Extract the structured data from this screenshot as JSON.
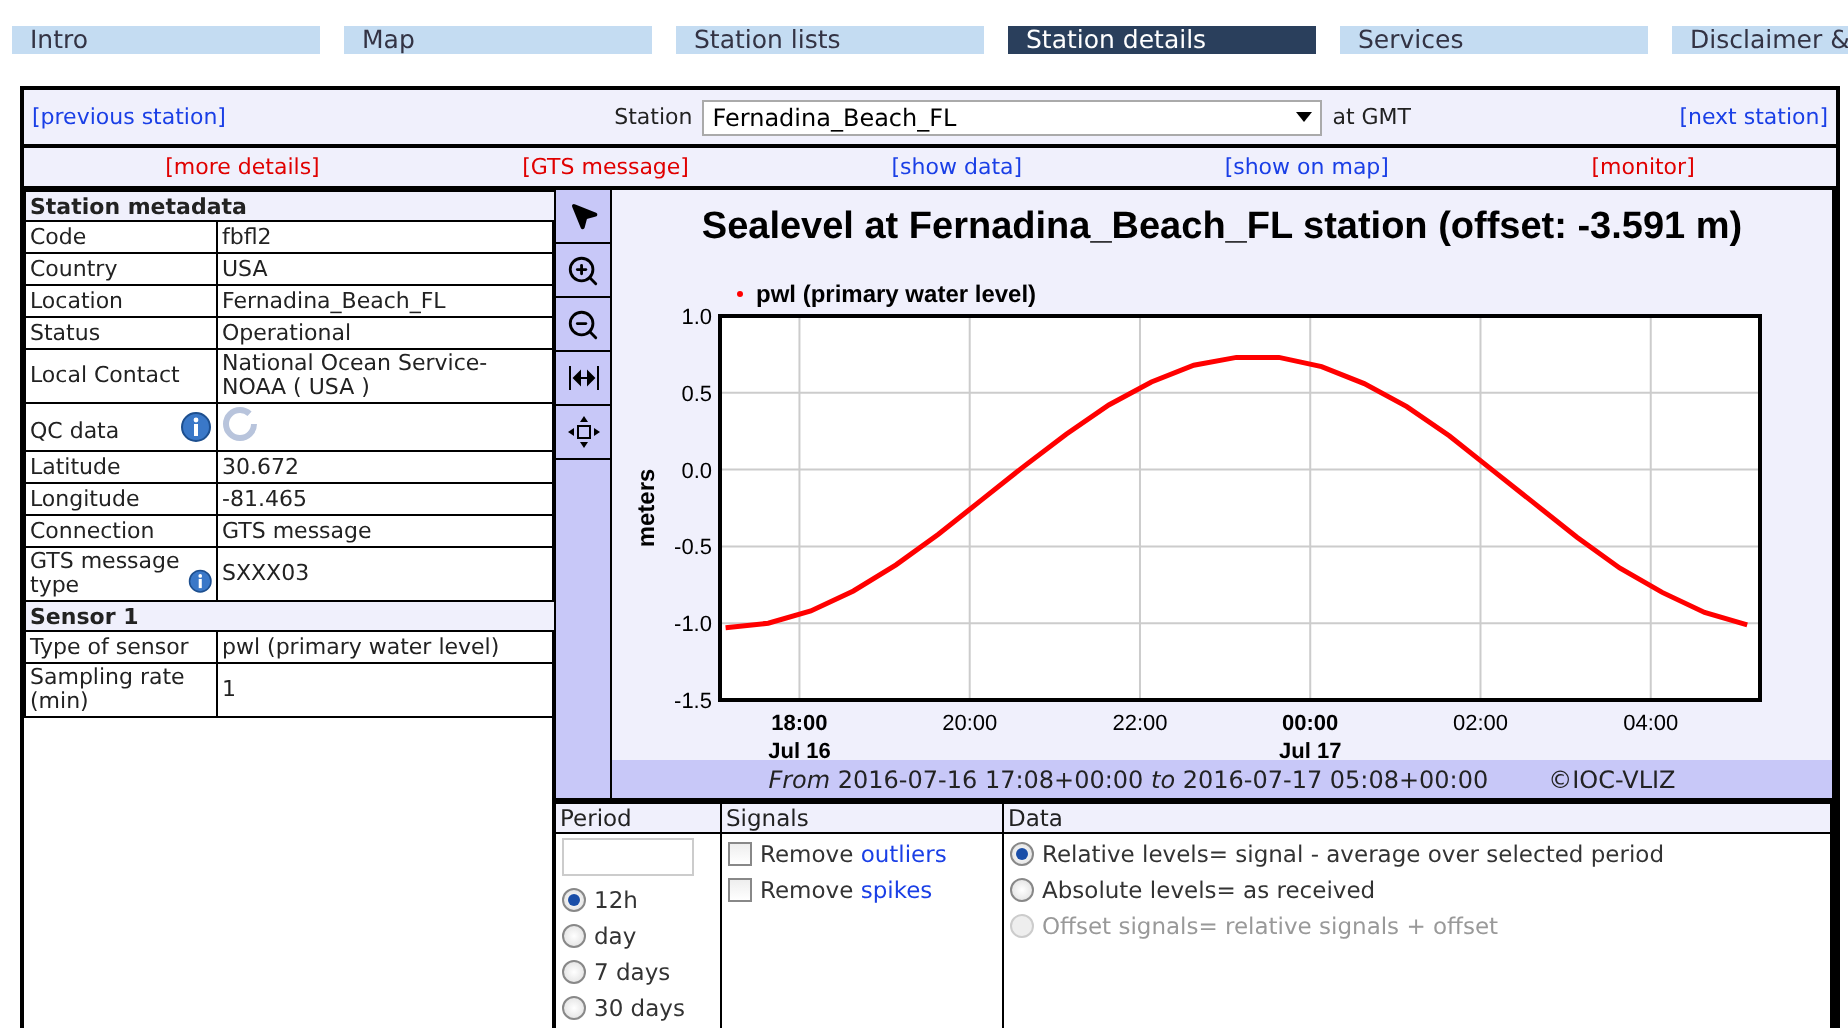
{
  "nav_tabs": [
    {
      "label": "Intro",
      "selected": false
    },
    {
      "label": "Map",
      "selected": false
    },
    {
      "label": "Station lists",
      "selected": false
    },
    {
      "label": "Station details",
      "selected": true
    },
    {
      "label": "Services",
      "selected": false
    },
    {
      "label": "Disclaimer &",
      "selected": false
    }
  ],
  "station_bar": {
    "previous": "[previous station]",
    "label": "Station",
    "value": "Fernadina_Beach_FL",
    "suffix": "at GMT",
    "next": "[next station]"
  },
  "links": [
    {
      "label": "[more details]",
      "color": "#e00000"
    },
    {
      "label": "[GTS message]",
      "color": "#e00000"
    },
    {
      "label": "[show data]",
      "color": "#1a3fe6"
    },
    {
      "label": "[show on map]",
      "color": "#1a3fe6"
    },
    {
      "label": "[monitor]",
      "color": "#e00000"
    }
  ],
  "metadata": [
    {
      "title": "Station metadata",
      "rows": [
        {
          "label": "Code",
          "value": "fbfl2",
          "kind": "text",
          "info": false
        },
        {
          "label": "Country",
          "value": "USA",
          "kind": "text",
          "info": false
        },
        {
          "label": "Location",
          "value": "Fernadina_Beach_FL",
          "kind": "text",
          "info": false
        },
        {
          "label": "Status",
          "value": "Operational",
          "kind": "text",
          "info": false
        },
        {
          "label": "Local Contact",
          "value": "National Ocean Service-NOAA ( USA )",
          "kind": "text",
          "info": false
        },
        {
          "label": "QC data",
          "kind": "spinner",
          "info": true
        },
        {
          "label": "Latitude",
          "value": "30.672",
          "kind": "text",
          "info": false
        },
        {
          "label": "Longitude",
          "value": "-81.465",
          "kind": "text",
          "info": false
        },
        {
          "label": "Connection",
          "value": "GTS message",
          "kind": "text",
          "info": false
        },
        {
          "label": "GTS message type",
          "value": "SXXX03",
          "kind": "text",
          "info": true
        }
      ]
    },
    {
      "title": "Sensor 1",
      "rows": [
        {
          "label": "Type of sensor",
          "value": "pwl (primary water level)",
          "kind": "text",
          "info": false
        },
        {
          "label": "Sampling rate (min)",
          "value": "1",
          "kind": "text",
          "info": false
        }
      ]
    }
  ],
  "toolbar": [
    {
      "kind": "pointer"
    },
    {
      "kind": "zoom-in"
    },
    {
      "kind": "zoom-out"
    },
    {
      "kind": "fit-width"
    },
    {
      "kind": "fit-all"
    }
  ],
  "chart": {
    "title": "Sealevel at Fernadina_Beach_FL station (offset: -3.591 m)",
    "chart_data": {
      "type": "line",
      "grid": true,
      "ylabel": "meters",
      "xlim": [
        "2016-07-16T17:04",
        "2016-07-17T05:17"
      ],
      "ylim": [
        -1.5,
        1.0
      ],
      "x": [
        "2016-07-16T17:08",
        "2016-07-16T17:38",
        "2016-07-16T18:08",
        "2016-07-16T18:38",
        "2016-07-16T19:08",
        "2016-07-16T19:38",
        "2016-07-16T20:08",
        "2016-07-16T20:38",
        "2016-07-16T21:08",
        "2016-07-16T21:38",
        "2016-07-16T22:08",
        "2016-07-16T22:38",
        "2016-07-16T23:08",
        "2016-07-16T23:38",
        "2016-07-17T00:08",
        "2016-07-17T00:38",
        "2016-07-17T01:08",
        "2016-07-17T01:38",
        "2016-07-17T02:08",
        "2016-07-17T02:38",
        "2016-07-17T03:08",
        "2016-07-17T03:38",
        "2016-07-17T04:08",
        "2016-07-17T04:38",
        "2016-07-17T05:08"
      ],
      "series": [
        {
          "name": "pwl (primary water level)",
          "color": "#ff0000",
          "values": [
            -1.03,
            -1.0,
            -0.92,
            -0.79,
            -0.62,
            -0.42,
            -0.2,
            0.02,
            0.23,
            0.42,
            0.57,
            0.68,
            0.73,
            0.73,
            0.67,
            0.56,
            0.41,
            0.22,
            0.0,
            -0.22,
            -0.44,
            -0.64,
            -0.8,
            -0.93,
            -1.01
          ]
        }
      ],
      "yticks": [
        {
          "value": 1.0,
          "label": "1.0"
        },
        {
          "value": 0.5,
          "label": "0.5"
        },
        {
          "value": 0,
          "label": "0.0"
        },
        {
          "value": -0.5,
          "label": "-0.5"
        },
        {
          "value": -1.0,
          "label": "-1.0"
        },
        {
          "value": -1.5,
          "label": "-1.5"
        }
      ],
      "xticks": [
        {
          "value": "2016-07-16T18:00",
          "label": "18:00"
        },
        {
          "value": "2016-07-16T20:00",
          "label": "20:00"
        },
        {
          "value": "2016-07-16T22:00",
          "label": "22:00"
        },
        {
          "value": "2016-07-17T00:00",
          "label": "00:00"
        },
        {
          "value": "2016-07-17T02:00",
          "label": "02:00"
        },
        {
          "value": "2016-07-17T04:00",
          "label": "04:00"
        }
      ],
      "annotations": [
        "Jul 16",
        "Jul 17"
      ]
    },
    "range": "*From* 2016-07-16 17:08+00:00 *to* 2016-07-17 05:08+00:00",
    "credit": "©IOC-VLIZ"
  },
  "period": {
    "title": "Period",
    "options": [
      {
        "label": "12h",
        "selected": true
      },
      {
        "label": "day",
        "selected": false
      },
      {
        "label": "7 days",
        "selected": false
      },
      {
        "label": "30 days",
        "selected": false
      }
    ]
  },
  "signals": {
    "title": "Signals",
    "options": [
      {
        "text": "Remove",
        "link": "outliers",
        "checked": false
      },
      {
        "text": "Remove",
        "link": "spikes",
        "checked": false
      }
    ]
  },
  "data": {
    "title": "Data",
    "options": [
      {
        "label": "Relative levels= signal - average over selected period",
        "selected": true,
        "disabled": false
      },
      {
        "label": "Absolute levels= as received",
        "selected": false,
        "disabled": false
      },
      {
        "label": "Offset signals= relative signals + offset",
        "selected": false,
        "disabled": true
      }
    ]
  }
}
